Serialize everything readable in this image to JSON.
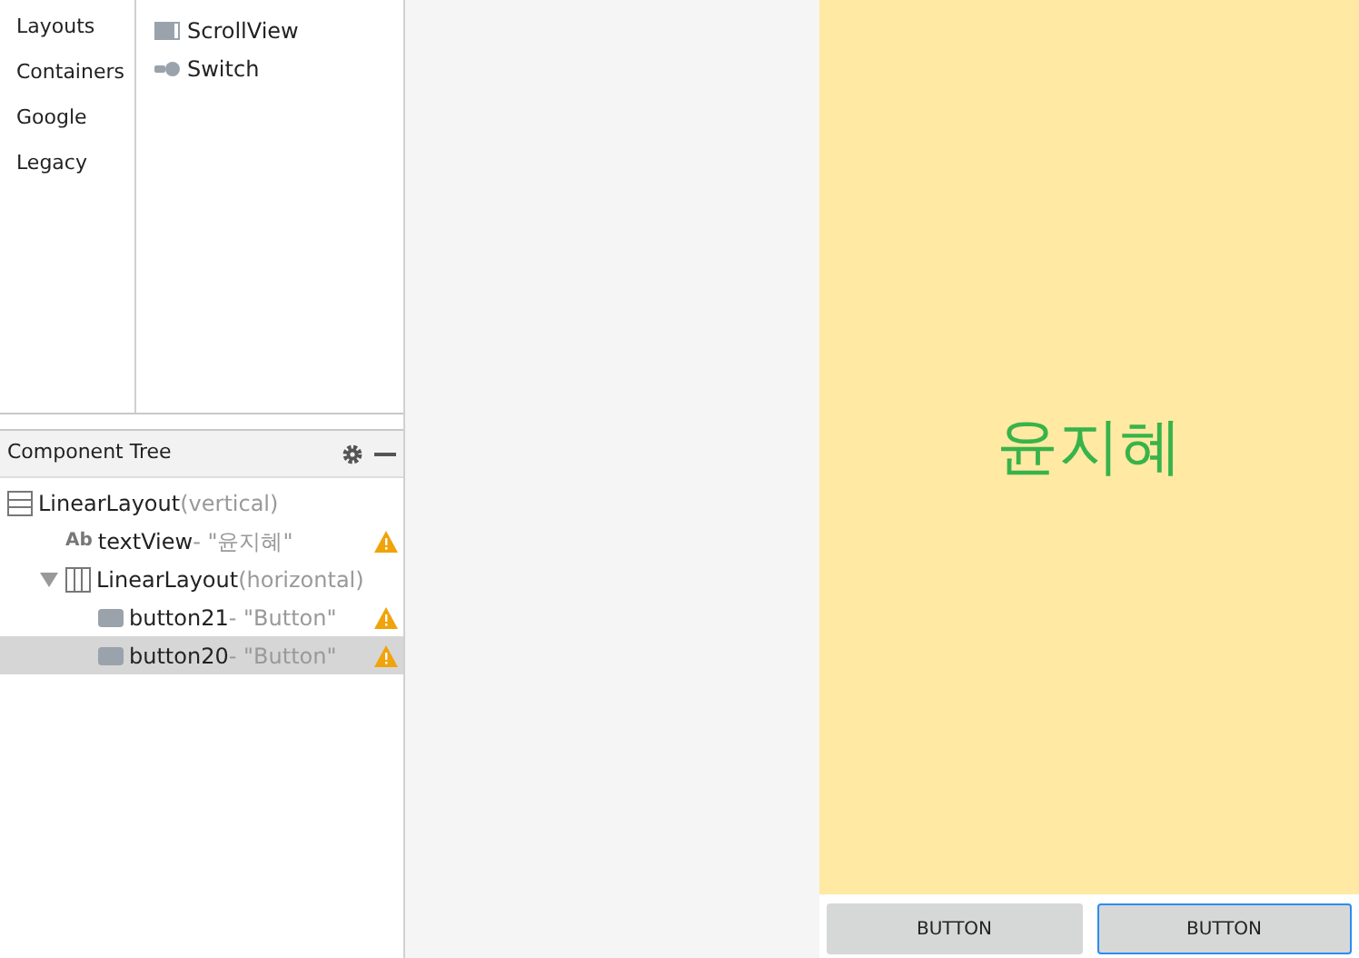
{
  "palette": {
    "categories": [
      "Layouts",
      "Containers",
      "Google",
      "Legacy"
    ],
    "items": [
      {
        "label": "ScrollView",
        "kind": "scroll"
      },
      {
        "label": "Switch",
        "kind": "switch"
      }
    ]
  },
  "component_tree": {
    "title": "Component Tree",
    "nodes": [
      {
        "name": "LinearLayout",
        "detail": "(vertical)",
        "kind": "vlayout",
        "warning": false,
        "selected": false,
        "children": [
          {
            "name": "textView",
            "detail": "- \"윤지혜\"",
            "kind": "text",
            "icon_text": "Ab",
            "warning": true,
            "selected": false
          },
          {
            "name": "LinearLayout",
            "detail": "(horizontal)",
            "kind": "hlayout",
            "warning": false,
            "selected": false,
            "expanded": true,
            "children": [
              {
                "name": "button21",
                "detail": "- \"Button\"",
                "kind": "button",
                "warning": true,
                "selected": false
              },
              {
                "name": "button20",
                "detail": "- \"Button\"",
                "kind": "button",
                "warning": true,
                "selected": true
              }
            ]
          }
        ]
      }
    ]
  },
  "preview": {
    "text": "윤지혜",
    "buttons": [
      {
        "label": "BUTTON",
        "selected": false
      },
      {
        "label": "BUTTON",
        "selected": true
      }
    ]
  }
}
